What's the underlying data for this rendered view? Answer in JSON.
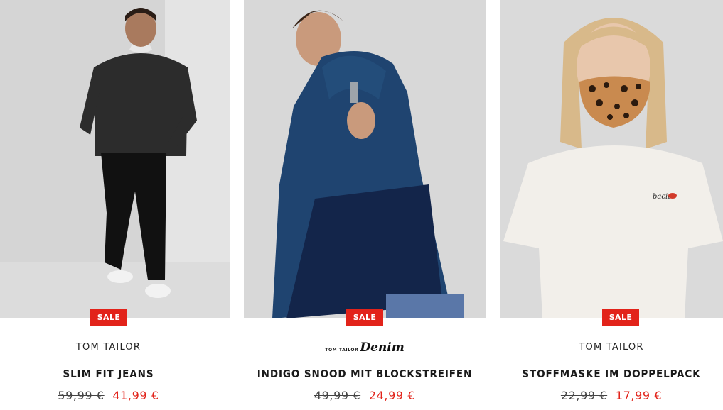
{
  "products": [
    {
      "badge": "SALE",
      "brand": "TOM TAILOR",
      "title": "SLIM FIT JEANS",
      "old_price": "59,99 €",
      "new_price": "41,99 €"
    },
    {
      "badge": "SALE",
      "brand_small": "TOM TAILOR",
      "brand_script": "Denim",
      "title": "INDIGO SNOOD MIT BLOCKSTREIFEN",
      "old_price": "49,99 €",
      "new_price": "24,99 €"
    },
    {
      "badge": "SALE",
      "brand": "TOM TAILOR",
      "title": "STOFFMASKE IM DOPPELPACK",
      "old_price": "22,99 €",
      "new_price": "17,99 €"
    }
  ],
  "colors": {
    "sale_red": "#e2231a",
    "photo_bg": "#d9d9d9",
    "text": "#1a1a1a"
  }
}
